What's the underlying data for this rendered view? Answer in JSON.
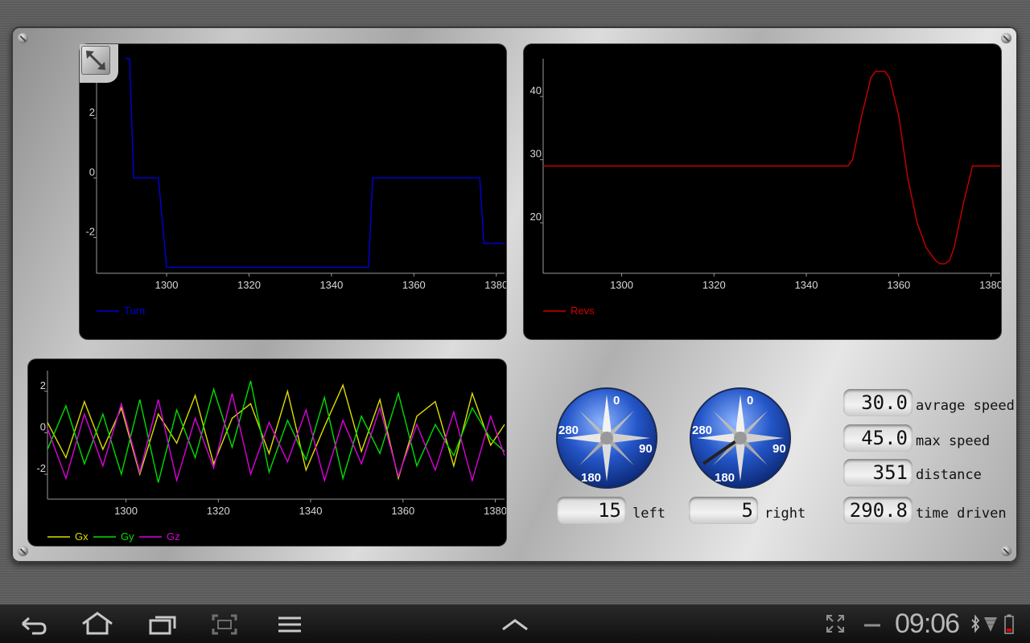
{
  "charts": {
    "turn": {
      "series_name": "Turn",
      "color": "#0000dd",
      "xticks": [
        "1300",
        "1320",
        "1340",
        "1360",
        "1380"
      ],
      "yticks": [
        "2",
        "0",
        "-2"
      ]
    },
    "revs": {
      "series_name": "Revs",
      "color": "#cc0000",
      "xticks": [
        "1300",
        "1320",
        "1340",
        "1360",
        "1380"
      ],
      "yticks": [
        "40",
        "30",
        "20"
      ]
    },
    "gyro": {
      "series_names": [
        "Gx",
        "Gy",
        "Gz"
      ],
      "colors": [
        "#dddd00",
        "#00dd00",
        "#dd00dd"
      ],
      "xticks": [
        "1300",
        "1320",
        "1340",
        "1360",
        "1380"
      ],
      "yticks": [
        "2",
        "0",
        "-2"
      ]
    }
  },
  "chart_data": [
    {
      "type": "line",
      "series": [
        {
          "name": "Turn",
          "x": [
            1290,
            1291,
            1292,
            1298,
            1300,
            1349,
            1350,
            1376,
            1377,
            1382
          ],
          "y": [
            4,
            4,
            0,
            0,
            -3,
            -3,
            0,
            0,
            -2.2,
            -2.2
          ]
        }
      ],
      "xlim": [
        1283,
        1382
      ],
      "ylim": [
        -3.2,
        4
      ],
      "legend": "bottom-left",
      "grid": false
    },
    {
      "type": "line",
      "series": [
        {
          "name": "Revs",
          "x": [
            1283,
            1349,
            1350,
            1352,
            1354,
            1355,
            1356,
            1357,
            1358,
            1360,
            1362,
            1364,
            1366,
            1368,
            1369,
            1370,
            1371,
            1372,
            1374,
            1376,
            1378,
            1382
          ],
          "y": [
            29,
            29,
            30,
            37,
            43,
            44,
            44,
            44,
            43,
            37,
            27,
            20,
            16,
            14,
            13.5,
            13.5,
            14,
            16,
            23,
            29,
            29,
            29
          ]
        }
      ],
      "xlim": [
        1283,
        1382
      ],
      "ylim": [
        12,
        46
      ],
      "legend": "bottom-left",
      "grid": false
    },
    {
      "type": "line",
      "series": [
        {
          "name": "Gx",
          "x": [
            1283,
            1287,
            1291,
            1295,
            1299,
            1303,
            1307,
            1311,
            1315,
            1319,
            1323,
            1327,
            1331,
            1335,
            1339,
            1343,
            1347,
            1351,
            1355,
            1359,
            1363,
            1367,
            1371,
            1375,
            1379,
            1382
          ],
          "y": [
            0.5,
            -1.2,
            1.5,
            -0.8,
            1.2,
            -2.0,
            0.9,
            -0.5,
            1.8,
            -1.5,
            0.7,
            1.4,
            -1.0,
            2.0,
            -1.8,
            0.3,
            2.3,
            -0.9,
            1.6,
            -2.2,
            0.8,
            1.5,
            -1.6,
            1.9,
            -0.6,
            0.4
          ]
        },
        {
          "name": "Gy",
          "x": [
            1283,
            1287,
            1291,
            1295,
            1299,
            1303,
            1307,
            1311,
            1315,
            1319,
            1323,
            1327,
            1331,
            1335,
            1339,
            1343,
            1347,
            1351,
            1355,
            1359,
            1363,
            1367,
            1371,
            1375,
            1379,
            1382
          ],
          "y": [
            -0.8,
            1.3,
            -1.5,
            0.9,
            -2.0,
            1.6,
            -2.4,
            1.1,
            -1.2,
            2.1,
            -0.7,
            2.5,
            -1.9,
            0.6,
            -1.3,
            1.7,
            -2.2,
            0.8,
            -1.0,
            1.9,
            -1.6,
            0.4,
            -1.1,
            1.2,
            -0.3,
            -0.9
          ]
        },
        {
          "name": "Gz",
          "x": [
            1283,
            1287,
            1291,
            1295,
            1299,
            1303,
            1307,
            1311,
            1315,
            1319,
            1323,
            1327,
            1331,
            1335,
            1339,
            1343,
            1347,
            1351,
            1355,
            1359,
            1363,
            1367,
            1371,
            1375,
            1379,
            1382
          ],
          "y": [
            0.2,
            -2.2,
            0.9,
            -1.6,
            1.4,
            -1.9,
            1.6,
            -2.3,
            0.7,
            -1.7,
            1.9,
            -2.0,
            0.5,
            -1.4,
            1.1,
            -2.3,
            0.6,
            -1.5,
            1.2,
            -2.1,
            0.4,
            -1.8,
            1.0,
            -2.3,
            0.8,
            -1.1
          ]
        }
      ],
      "xlim": [
        1283,
        1382
      ],
      "ylim": [
        -3.2,
        3
      ],
      "legend": "bottom-left",
      "grid": false
    }
  ],
  "compass_left": {
    "n": "0",
    "e": "90",
    "s": "180",
    "w": "280",
    "value": "15",
    "label": "left"
  },
  "compass_right": {
    "n": "0",
    "e": "90",
    "s": "180",
    "w": "280",
    "value": "5",
    "label": "right"
  },
  "stats": [
    {
      "value": "30.0",
      "label": "avrage speed"
    },
    {
      "value": "45.0",
      "label": "max speed"
    },
    {
      "value": "351",
      "label": "distance"
    },
    {
      "value": "290.8",
      "label": "time driven"
    }
  ],
  "navbar": {
    "clock": "09:06",
    "icons": [
      "back-icon",
      "home-icon",
      "recent-apps-icon",
      "screenshot-icon",
      "menu-icon",
      "up-arrow-icon",
      "fullscreen-icon",
      "minimize-icon",
      "bluetooth-icon",
      "signal-icon",
      "battery-icon"
    ]
  }
}
